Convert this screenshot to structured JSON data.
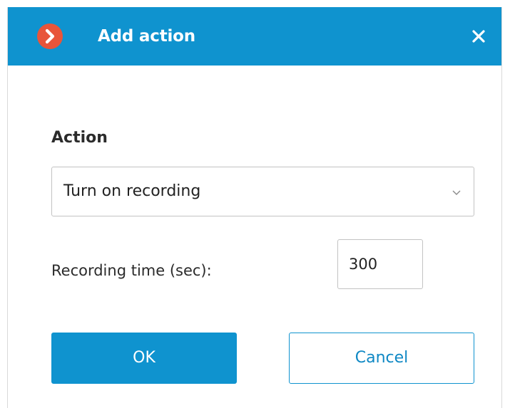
{
  "dialog": {
    "title": "Add action",
    "close_icon": "close-icon",
    "logo_icon": "app-logo-icon"
  },
  "action": {
    "label": "Action",
    "selected": "Turn on recording"
  },
  "recording_time": {
    "label": "Recording time (sec):",
    "value": "300"
  },
  "buttons": {
    "ok": "OK",
    "cancel": "Cancel"
  },
  "colors": {
    "accent": "#0f93cf",
    "logo": "#e8553a",
    "text": "#2b2b2b",
    "border": "#c3c3c3"
  }
}
